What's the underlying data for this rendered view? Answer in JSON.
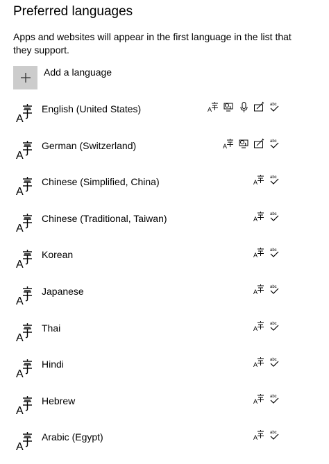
{
  "page": {
    "title": "Preferred languages",
    "description": "Apps and websites will appear in the first language in the list that they support."
  },
  "add_language": {
    "label": "Add a language",
    "icon": "plus-icon"
  },
  "feature_icons": {
    "display-language": "language-pack-icon",
    "text-to-speech": "text-to-speech-icon",
    "speech": "speech-recognition-icon",
    "handwriting": "handwriting-icon",
    "spelling": "spell-check-icon"
  },
  "languages": [
    {
      "name": "English (United States)",
      "features": [
        "display-language",
        "text-to-speech",
        "speech",
        "handwriting",
        "spelling"
      ]
    },
    {
      "name": "German (Switzerland)",
      "features": [
        "display-language",
        "text-to-speech",
        "handwriting",
        "spelling"
      ]
    },
    {
      "name": "Chinese (Simplified, China)",
      "features": [
        "display-language",
        "spelling"
      ]
    },
    {
      "name": "Chinese (Traditional, Taiwan)",
      "features": [
        "display-language",
        "spelling"
      ]
    },
    {
      "name": "Korean",
      "features": [
        "display-language",
        "spelling"
      ]
    },
    {
      "name": "Japanese",
      "features": [
        "display-language",
        "spelling"
      ]
    },
    {
      "name": "Thai",
      "features": [
        "display-language",
        "spelling"
      ]
    },
    {
      "name": "Hindi",
      "features": [
        "display-language",
        "spelling"
      ]
    },
    {
      "name": "Hebrew",
      "features": [
        "display-language",
        "spelling"
      ]
    },
    {
      "name": "Arabic (Egypt)",
      "features": [
        "display-language",
        "spelling"
      ]
    }
  ]
}
